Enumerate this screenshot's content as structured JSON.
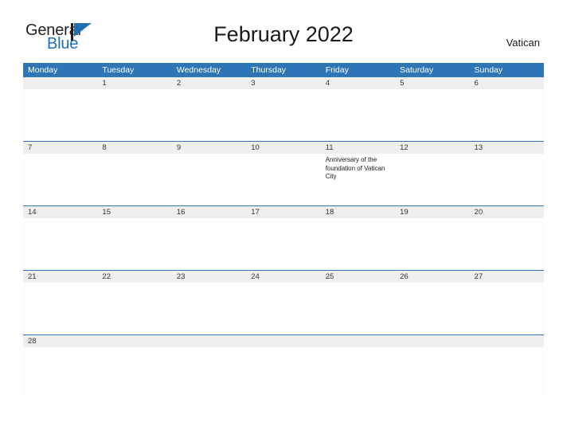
{
  "brand": {
    "logo_text_primary": "General",
    "logo_text_secondary": "Blue",
    "logo_mark_icon": "triangle-flag-icon",
    "logo_mark_color": "#1f6fb2"
  },
  "header": {
    "title": "February 2022",
    "country": "Vatican"
  },
  "theme": {
    "header_blue": "#2e75b6",
    "row_band_gray": "#efefef",
    "cell_background": "#fdfdfd",
    "text_dark": "#1a1a1a",
    "logo_blue": "#1f6fb2"
  },
  "calendar": {
    "month": "February",
    "year": "2022",
    "weekday_headers": [
      "Monday",
      "Tuesday",
      "Wednesday",
      "Thursday",
      "Friday",
      "Saturday",
      "Sunday"
    ],
    "weeks": [
      [
        {
          "day": "",
          "events": []
        },
        {
          "day": "1",
          "events": []
        },
        {
          "day": "2",
          "events": []
        },
        {
          "day": "3",
          "events": []
        },
        {
          "day": "4",
          "events": []
        },
        {
          "day": "5",
          "events": []
        },
        {
          "day": "6",
          "events": []
        }
      ],
      [
        {
          "day": "7",
          "events": []
        },
        {
          "day": "8",
          "events": []
        },
        {
          "day": "9",
          "events": []
        },
        {
          "day": "10",
          "events": []
        },
        {
          "day": "11",
          "events": [
            "Anniversary of the foundation of Vatican City"
          ]
        },
        {
          "day": "12",
          "events": []
        },
        {
          "day": "13",
          "events": []
        }
      ],
      [
        {
          "day": "14",
          "events": []
        },
        {
          "day": "15",
          "events": []
        },
        {
          "day": "16",
          "events": []
        },
        {
          "day": "17",
          "events": []
        },
        {
          "day": "18",
          "events": []
        },
        {
          "day": "19",
          "events": []
        },
        {
          "day": "20",
          "events": []
        }
      ],
      [
        {
          "day": "21",
          "events": []
        },
        {
          "day": "22",
          "events": []
        },
        {
          "day": "23",
          "events": []
        },
        {
          "day": "24",
          "events": []
        },
        {
          "day": "25",
          "events": []
        },
        {
          "day": "26",
          "events": []
        },
        {
          "day": "27",
          "events": []
        }
      ],
      [
        {
          "day": "28",
          "events": []
        },
        {
          "day": "",
          "events": []
        },
        {
          "day": "",
          "events": []
        },
        {
          "day": "",
          "events": []
        },
        {
          "day": "",
          "events": []
        },
        {
          "day": "",
          "events": []
        },
        {
          "day": "",
          "events": []
        }
      ]
    ]
  }
}
